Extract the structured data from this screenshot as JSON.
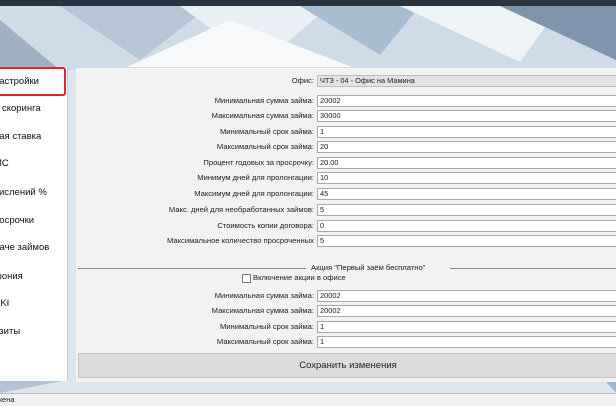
{
  "sidebar": {
    "items": [
      {
        "label": "настройки",
        "active": true
      },
      {
        "label": "и скоринга"
      },
      {
        "label": "ная ставка"
      },
      {
        "label": "МС"
      },
      {
        "label": "числений %"
      },
      {
        "label": "росрочки"
      },
      {
        "label": "даче займов"
      },
      {
        "label": "фония"
      },
      {
        "label": "SKI"
      },
      {
        "label": "изиты"
      }
    ]
  },
  "form": {
    "office": {
      "label": "Офис:",
      "value": "ЧТЗ - 04 - Офис на Мамина"
    },
    "fields": [
      {
        "label": "Минимальная сумма займа:",
        "value": "20002"
      },
      {
        "label": "Максимальная сумма займа:",
        "value": "30000"
      },
      {
        "label": "Минимальный срок займа:",
        "value": "1"
      },
      {
        "label": "Максимальный срок займа:",
        "value": "20"
      },
      {
        "label": "Процент годовых за просрочку:",
        "value": "20.00"
      },
      {
        "label": "Минимум дней для пролонгации:",
        "value": "10"
      },
      {
        "label": "Максимум дней для пролонгации:",
        "value": "45"
      },
      {
        "label": "Макс. дней для необработанных займов:",
        "value": "5"
      },
      {
        "label": "Стоимость копии договора:",
        "value": "0"
      },
      {
        "label": "Максимальное количество просроченных",
        "value": "5"
      }
    ],
    "promo": {
      "title": "Акция \"Первый заём бесплатно\"",
      "checkbox_label": "Включение акции в офисе",
      "checkbox_checked": false,
      "fields": [
        {
          "label": "Минимальная сумма займа:",
          "value": "20002"
        },
        {
          "label": "Максимальная сумма займа:",
          "value": "20002"
        },
        {
          "label": "Минимальный срок займа:",
          "value": "1"
        },
        {
          "label": "Максимальный срок займа:",
          "value": "1"
        }
      ]
    },
    "save_label": "Сохранить изменения"
  },
  "status": {
    "text": "жена"
  }
}
